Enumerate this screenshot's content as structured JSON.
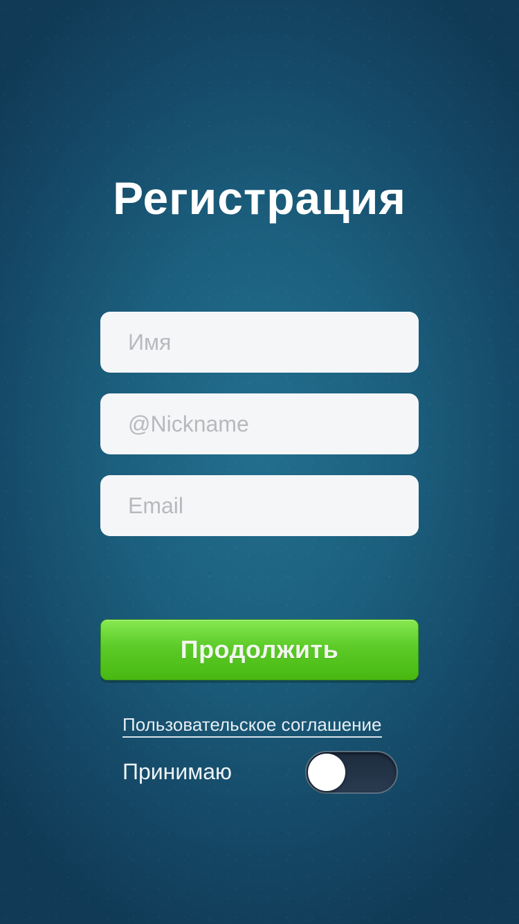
{
  "screen": {
    "title": "Регистрация"
  },
  "form": {
    "name_placeholder": "Имя",
    "nickname_placeholder": "@Nickname",
    "email_placeholder": "Email",
    "name_value": "",
    "nickname_value": "",
    "email_value": ""
  },
  "actions": {
    "continue_label": "Продолжить"
  },
  "agreement": {
    "link_label": "Пользовательское соглашение",
    "accept_label": "Принимаю",
    "accept_toggle_on": false
  },
  "colors": {
    "background": "#1c5f7e",
    "button_green": "#5ccb28",
    "field_background": "#f5f6f8",
    "placeholder": "#b7b9bd",
    "toggle_track": "#23344a"
  },
  "icons": {
    "toggle": "toggle-switch-off"
  }
}
